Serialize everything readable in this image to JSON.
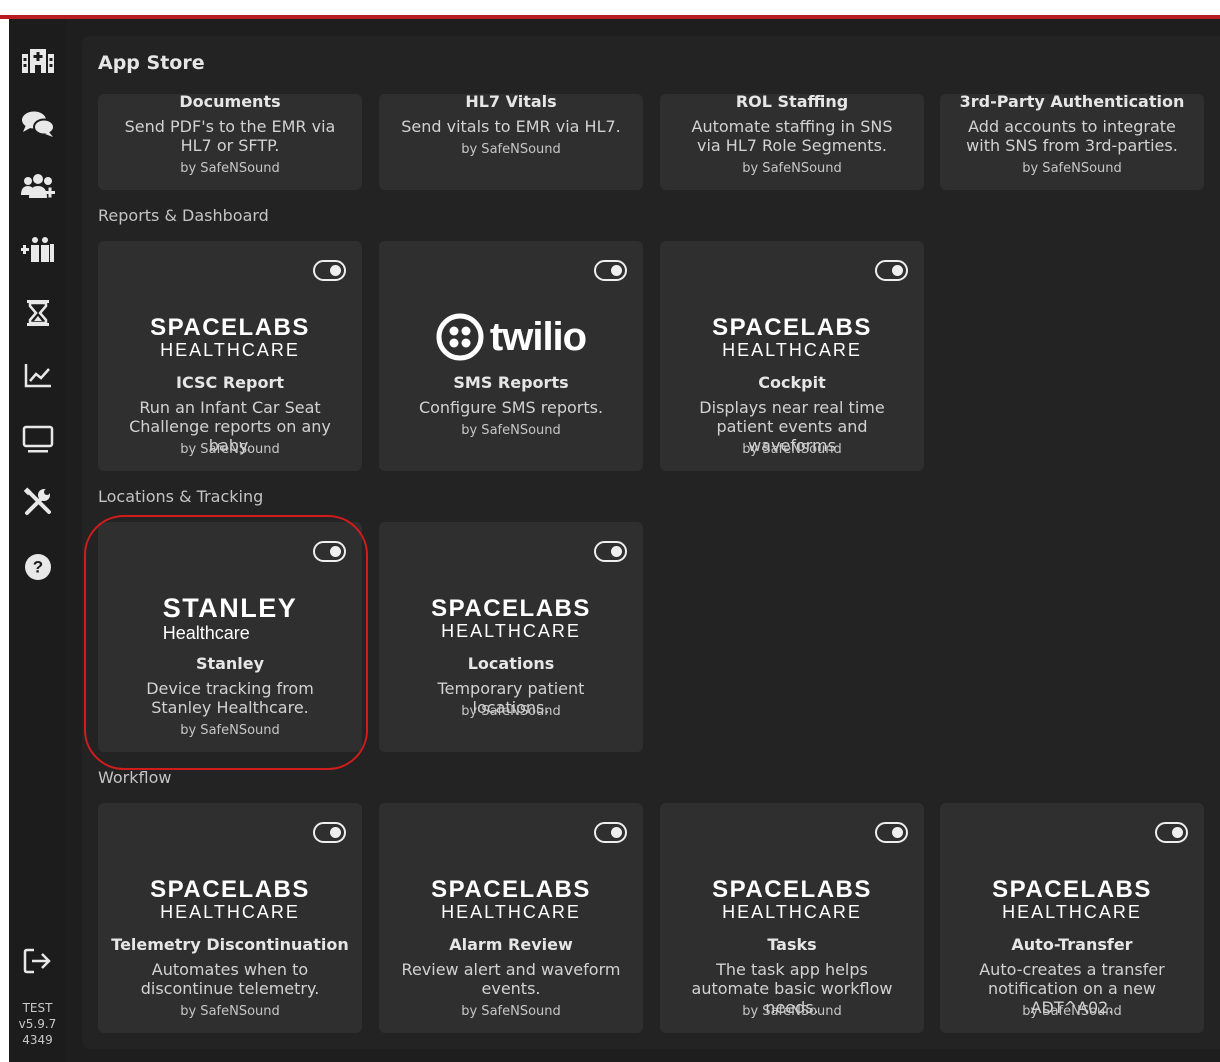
{
  "page": {
    "title": "App Store"
  },
  "sidebar": {
    "icons": [
      "hospital-icon",
      "chat-icon",
      "users-icon",
      "staff-icon",
      "hourglass-icon",
      "chart-icon",
      "monitor-icon",
      "tools-icon",
      "help-icon"
    ],
    "logout_icon": "logout-icon",
    "version": {
      "env": "TEST",
      "version": "v5.9.7",
      "build": "4349"
    }
  },
  "sections": {
    "top": {
      "cards": [
        {
          "name": "Documents",
          "description": "Send PDF's to the EMR via HL7 or SFTP.",
          "by": "by SafeNSound"
        },
        {
          "name": "HL7 Vitals",
          "description": "Send vitals to EMR via HL7.",
          "by": "by SafeNSound"
        },
        {
          "name": "ROL Staffing",
          "description": "Automate staffing in SNS via HL7 Role Segments.",
          "by": "by SafeNSound"
        },
        {
          "name": "3rd-Party Authentication",
          "description": "Add accounts to integrate with SNS from 3rd-parties.",
          "by": "by SafeNSound"
        }
      ]
    },
    "reports": {
      "label": "Reports & Dashboard",
      "cards": [
        {
          "name": "ICSC Report",
          "description": "Run an Infant Car Seat Challenge reports on any baby.",
          "by": "by SafeNSound",
          "logo": "spacelabs"
        },
        {
          "name": "SMS Reports",
          "description": "Configure SMS reports.",
          "by": "by SafeNSound",
          "logo": "twilio"
        },
        {
          "name": "Cockpit",
          "description": "Displays near real time patient events and waveforms",
          "by": "by SafeNSound",
          "logo": "spacelabs"
        }
      ]
    },
    "locations": {
      "label": "Locations & Tracking",
      "cards": [
        {
          "name": "Stanley",
          "description": "Device tracking from Stanley Healthcare.",
          "by": "by SafeNSound",
          "logo": "stanley"
        },
        {
          "name": "Locations",
          "description": "Temporary patient locations.",
          "by": "by SafeNSound",
          "logo": "spacelabs"
        }
      ]
    },
    "workflow": {
      "label": "Workflow",
      "cards": [
        {
          "name": "Telemetry Discontinuation",
          "description": "Automates when to discontinue telemetry.",
          "by": "by SafeNSound",
          "logo": "spacelabs"
        },
        {
          "name": "Alarm Review",
          "description": "Review alert and waveform events.",
          "by": "by SafeNSound",
          "logo": "spacelabs"
        },
        {
          "name": "Tasks",
          "description": "The task app helps automate basic workflow needs.",
          "by": "by SafeNSound",
          "logo": "spacelabs"
        },
        {
          "name": "Auto-Transfer",
          "description": "Auto-creates a transfer notification on a new ADT^A02.",
          "by": "by SafeNSound",
          "logo": "spacelabs"
        }
      ]
    }
  },
  "logos": {
    "spacelabs": {
      "line1": "SPACELABS",
      "line2": "HEALTHCARE"
    },
    "twilio": {
      "word": "twilio"
    },
    "stanley": {
      "line1": "STANLEY",
      "line2": "Healthcare"
    }
  },
  "colors": {
    "accent_red": "#d01c1c",
    "top_bar": "#b81d24",
    "card_bg": "#2f2f2f",
    "panel_bg": "#232323"
  }
}
